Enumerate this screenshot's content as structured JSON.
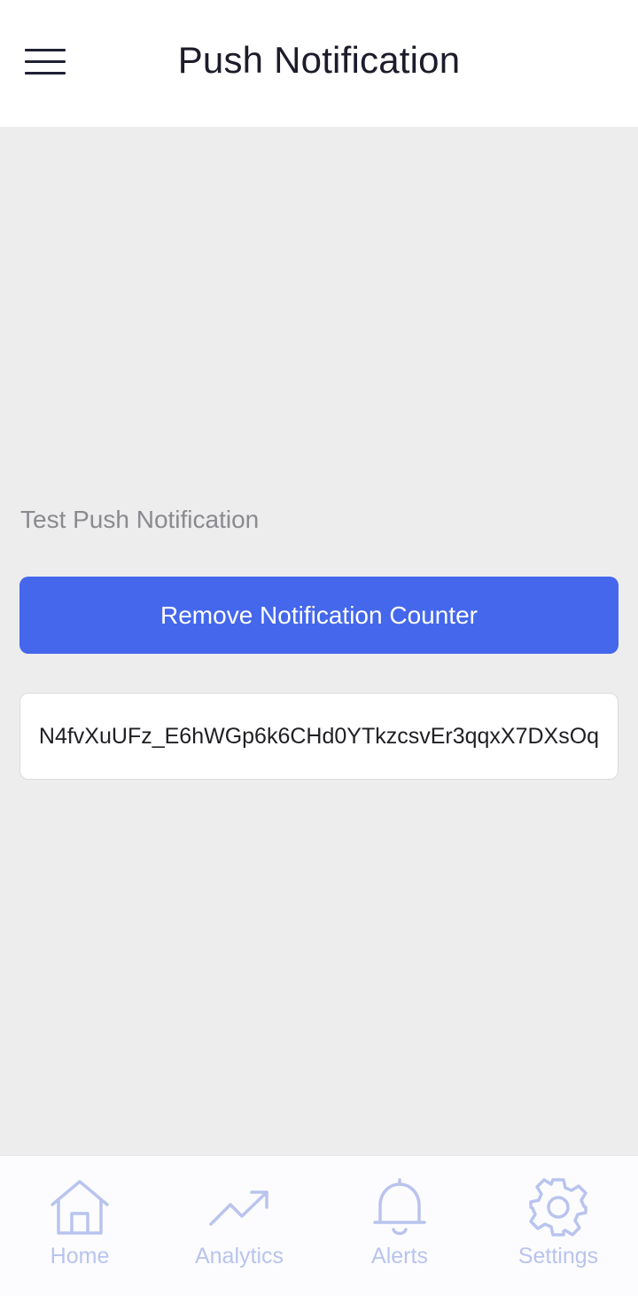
{
  "header": {
    "title": "Push Notification",
    "menu_icon": "hamburger-menu-icon"
  },
  "main": {
    "section_label": "Test Push Notification",
    "remove_counter_button": "Remove Notification Counter",
    "token": "N4fvXuUFz_E6hWGp6k6CHd0YTkzcsvEr3qqxX7DXsOq"
  },
  "tabbar": {
    "tabs": [
      {
        "label": "Home",
        "icon": "home-icon"
      },
      {
        "label": "Analytics",
        "icon": "trend-up-icon"
      },
      {
        "label": "Alerts",
        "icon": "bell-icon"
      },
      {
        "label": "Settings",
        "icon": "gear-icon"
      }
    ]
  },
  "colors": {
    "accent": "#4467ec",
    "background": "#ededee",
    "tab_inactive": "#b9c4ee"
  }
}
